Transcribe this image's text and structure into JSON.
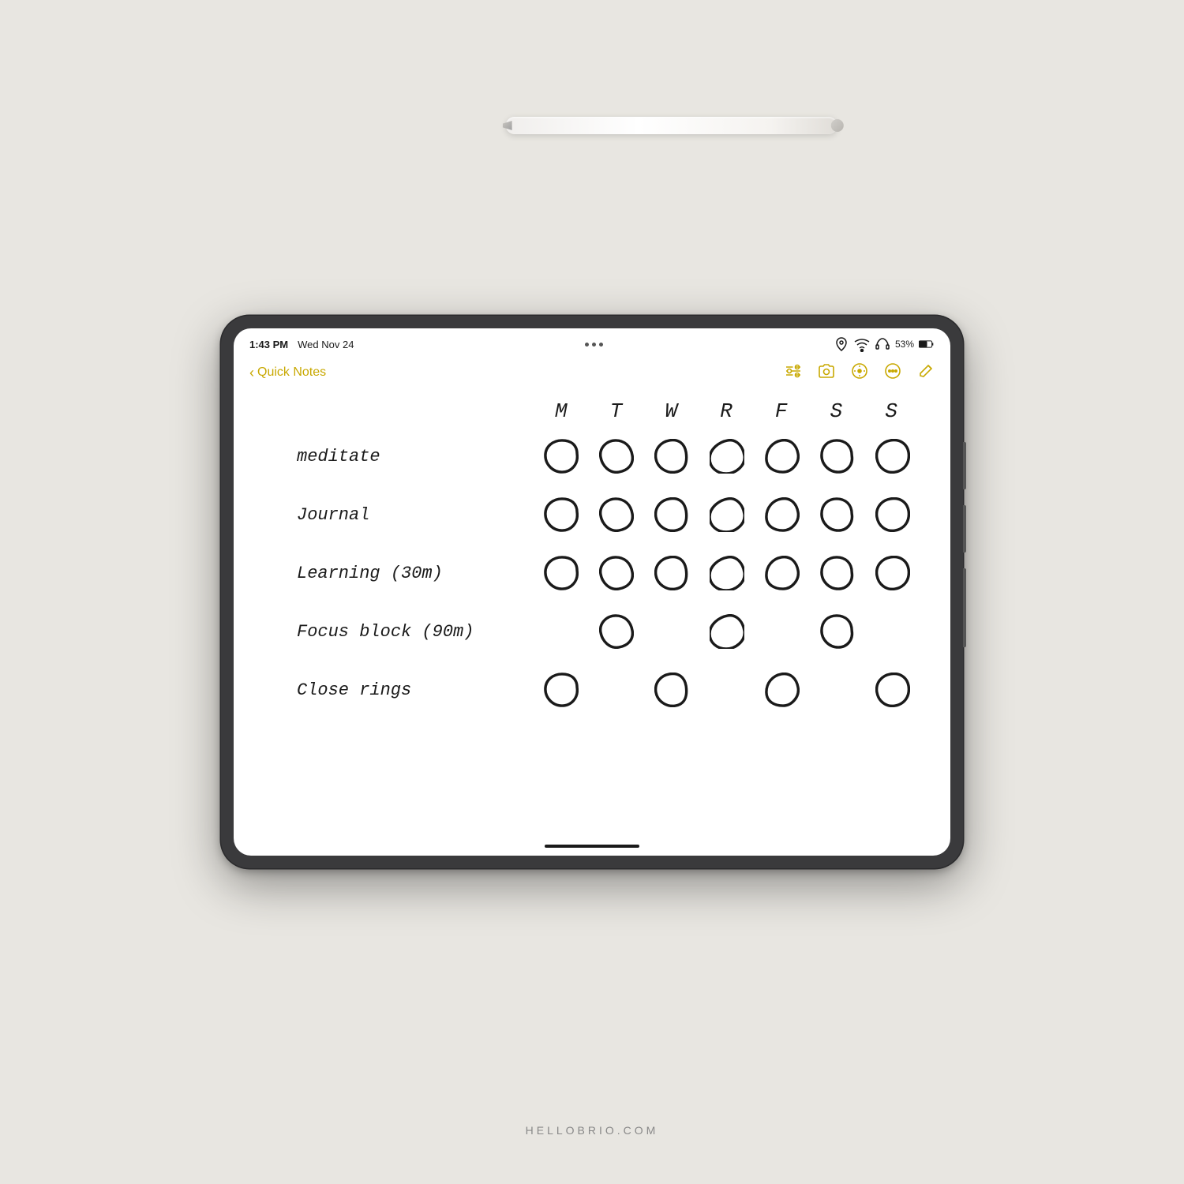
{
  "page": {
    "background_color": "#e8e6e1",
    "footer": "HELLOBRIO.COM"
  },
  "status_bar": {
    "time": "1:43 PM",
    "date": "Wed Nov 24",
    "battery": "53%",
    "dots": "···"
  },
  "nav": {
    "back_label": "Quick Notes",
    "back_chevron": "‹"
  },
  "tracker": {
    "days": [
      "M",
      "T",
      "W",
      "R",
      "F",
      "S",
      "S"
    ],
    "habits": [
      {
        "name": "meditate",
        "circles": [
          true,
          true,
          true,
          true,
          true,
          true,
          true
        ]
      },
      {
        "name": "Journal",
        "circles": [
          true,
          true,
          true,
          true,
          true,
          true,
          true
        ]
      },
      {
        "name": "Learning (30m)",
        "circles": [
          true,
          true,
          true,
          true,
          true,
          true,
          true
        ]
      },
      {
        "name": "Focus block (90m)",
        "circles": [
          false,
          true,
          false,
          true,
          false,
          true,
          false
        ]
      },
      {
        "name": "Close rings",
        "circles": [
          true,
          false,
          true,
          false,
          true,
          false,
          true
        ]
      }
    ]
  }
}
